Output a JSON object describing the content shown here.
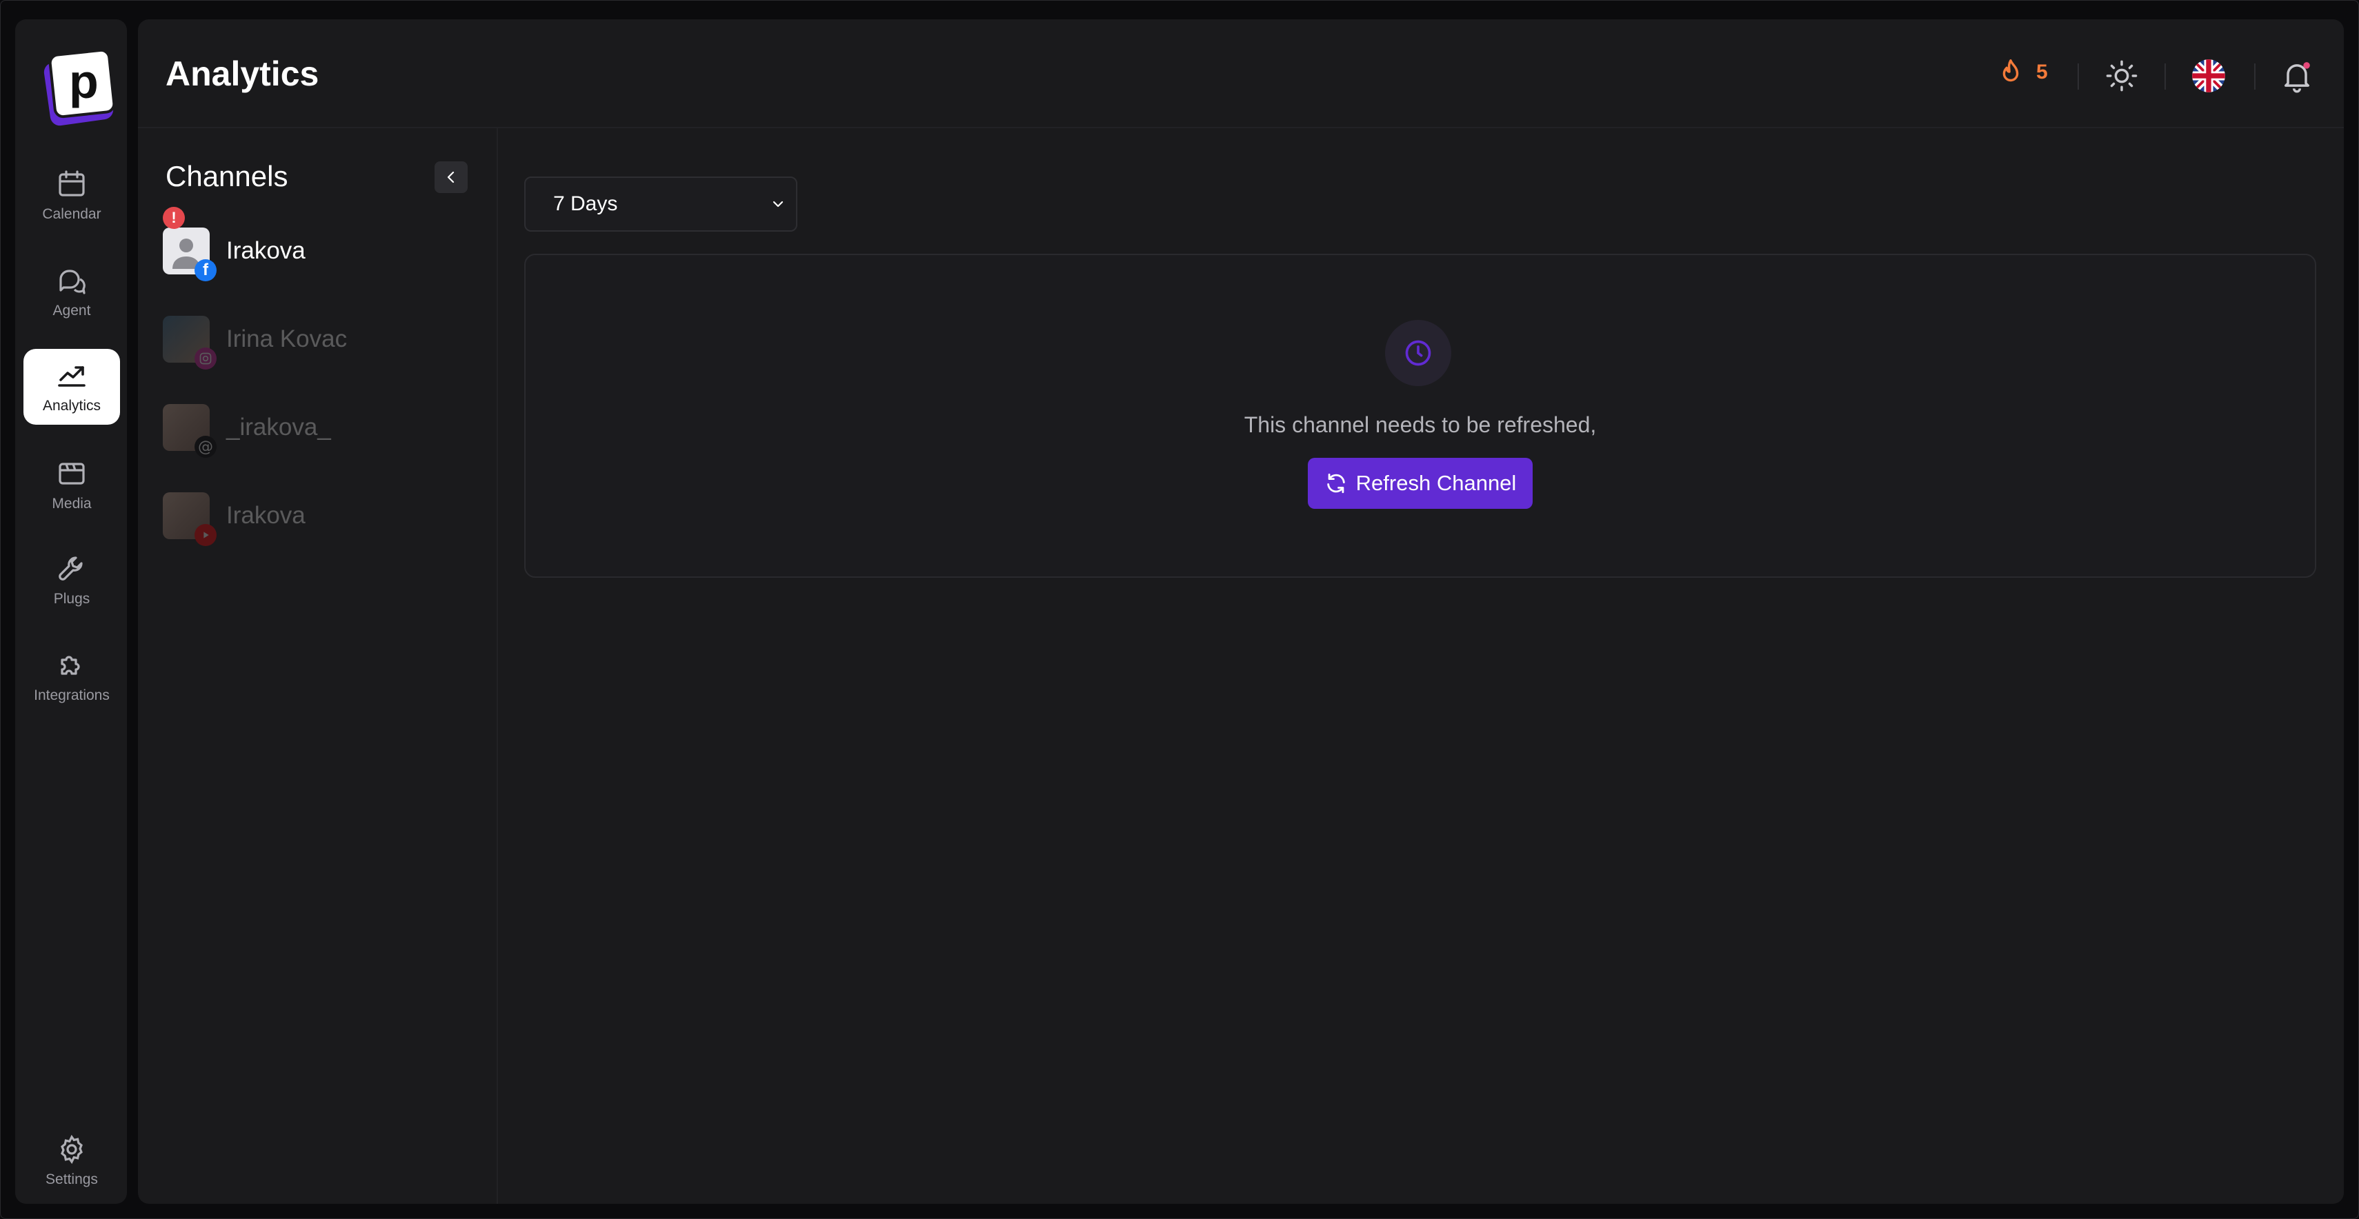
{
  "app": {
    "logo_letter": "p",
    "page_title": "Analytics"
  },
  "nav": [
    {
      "label": "Calendar",
      "icon": "calendar-icon",
      "active": false
    },
    {
      "label": "Agent",
      "icon": "chat-bubbles-icon",
      "active": false
    },
    {
      "label": "Analytics",
      "icon": "trend-chart-icon",
      "active": true
    },
    {
      "label": "Media",
      "icon": "media-icon",
      "active": false
    },
    {
      "label": "Plugs",
      "icon": "wrench-icon",
      "active": false
    },
    {
      "label": "Integrations",
      "icon": "puzzle-icon",
      "active": false
    },
    {
      "label": "Settings",
      "icon": "gear-icon",
      "active": false
    }
  ],
  "header": {
    "streak_count": "5",
    "streak_icon": "flame-icon",
    "theme_icon": "sun-icon",
    "language_icon": "uk-flag-icon",
    "notification_icon": "bell-icon"
  },
  "sidebar": {
    "title": "Channels",
    "channels": [
      {
        "name": "Irakova",
        "network": "facebook",
        "active": true,
        "has_error": true,
        "error_mark": "!"
      },
      {
        "name": "Irina Kovac",
        "network": "instagram",
        "active": false
      },
      {
        "name": "_irakova_",
        "network": "threads",
        "active": false
      },
      {
        "name": "Irakova",
        "network": "youtube",
        "active": false
      }
    ]
  },
  "filters": {
    "range_selected": "7 Days"
  },
  "notice": {
    "message": "This channel needs to be refreshed,",
    "button_label": "Refresh Channel"
  },
  "colors": {
    "accent": "#612bd3",
    "streak": "#f47b3a",
    "error": "#e5484d",
    "background": "#1a1a1c"
  }
}
